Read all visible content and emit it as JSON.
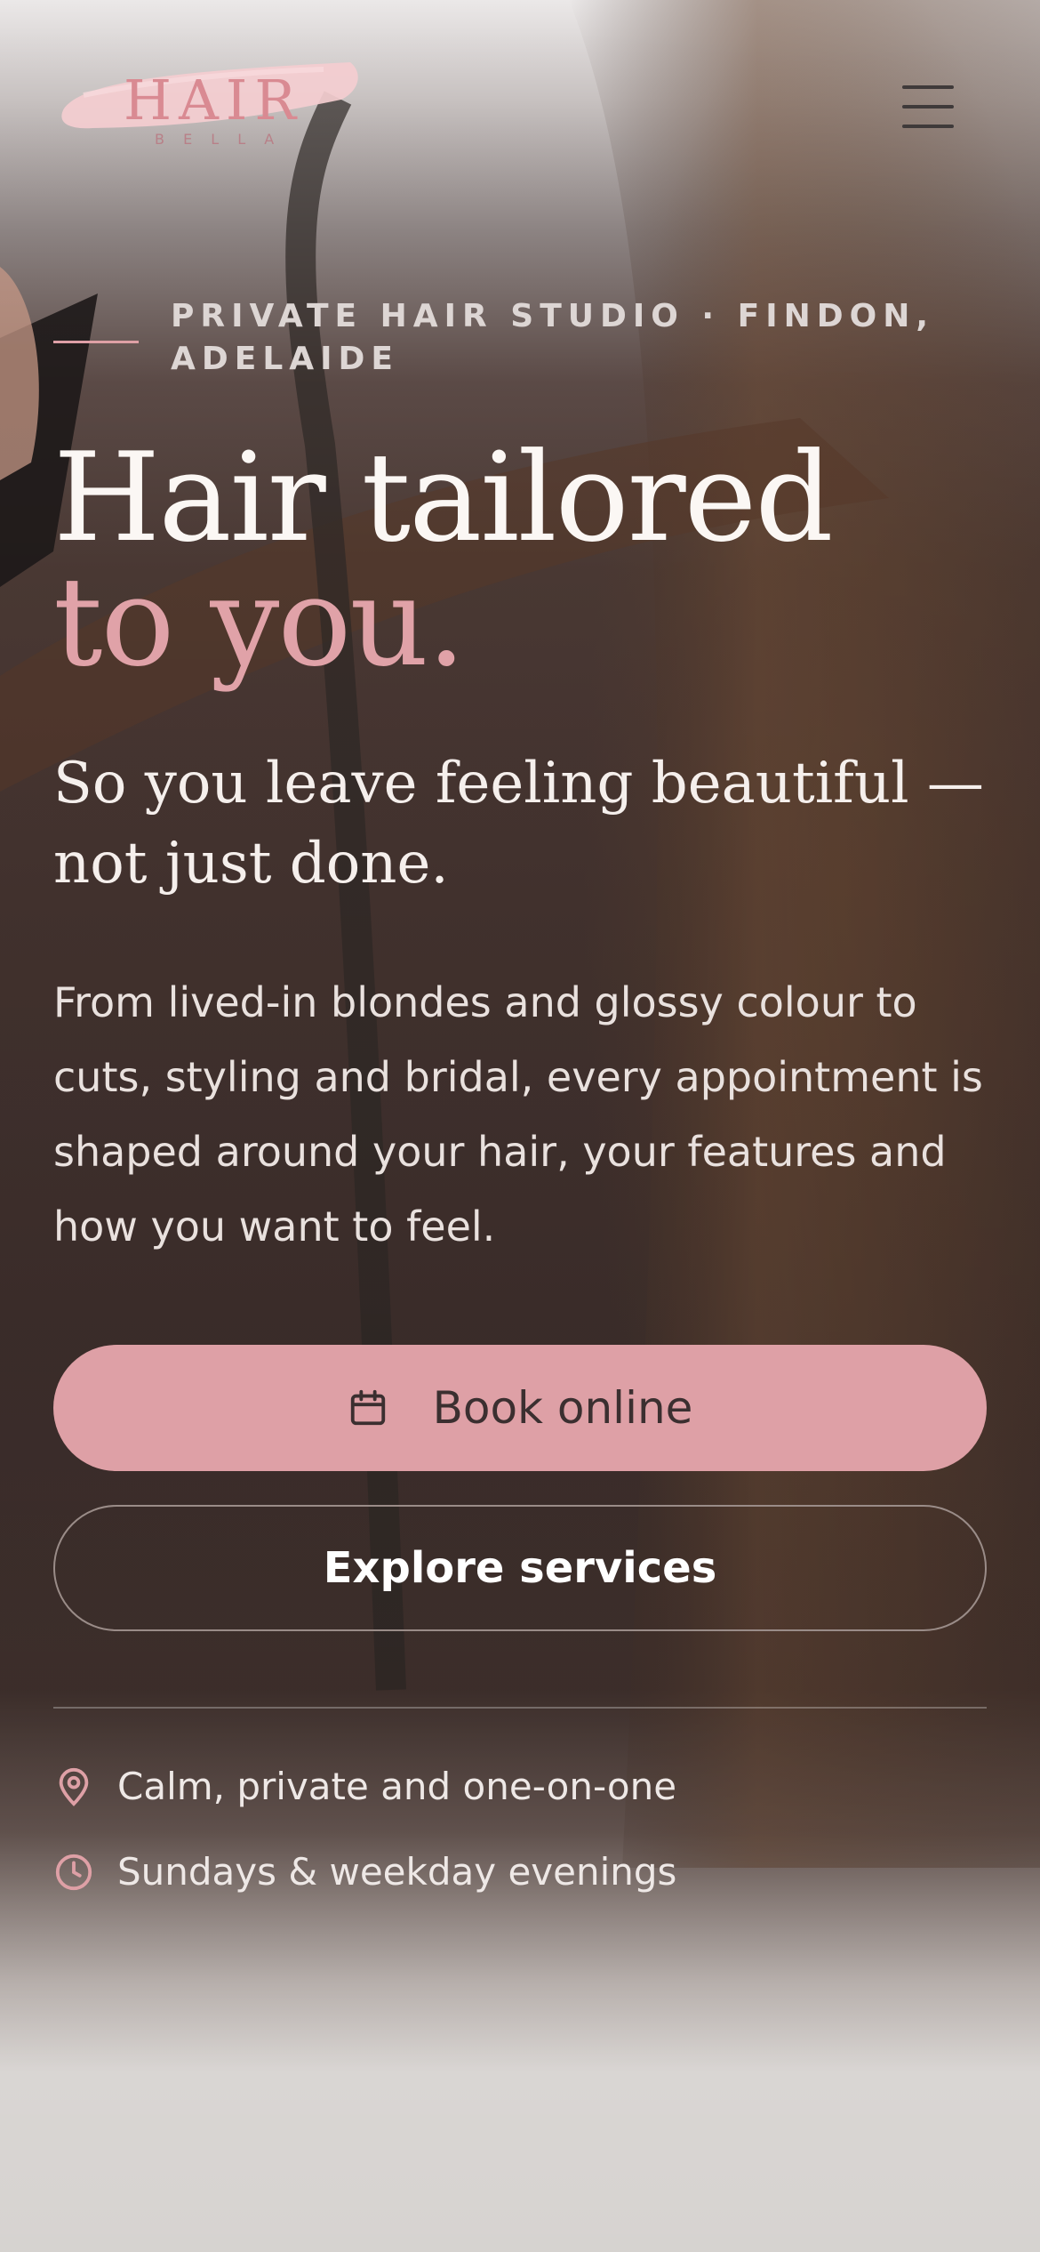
{
  "colors": {
    "accent_pink": "#dea0a6",
    "text_light": "#fbf7f4",
    "page_bg": "#fcf8f5",
    "button_text": "#3b2f30"
  },
  "header": {
    "logo_text": "HAIR",
    "logo_subtext": "B E L L A",
    "menu_icon": "hamburger-menu-icon"
  },
  "hero": {
    "eyebrow": "PRIVATE HAIR STUDIO · FINDON, ADELAIDE",
    "title_line1": "Hair tailored",
    "title_line2": "to you.",
    "subtitle": "So you leave feeling beautiful — not just done.",
    "body": "From lived-in blondes and glossy colour to cuts, styling and bridal, every appointment is shaped around your hair, your features and how you want to feel.",
    "primary_cta": {
      "label": "Book online",
      "icon": "calendar-icon"
    },
    "secondary_cta": {
      "label": "Explore services"
    },
    "features": [
      {
        "icon": "map-pin-icon",
        "text": "Calm, private and one-on-one"
      },
      {
        "icon": "clock-icon",
        "text": "Sundays & weekday evenings"
      }
    ]
  }
}
